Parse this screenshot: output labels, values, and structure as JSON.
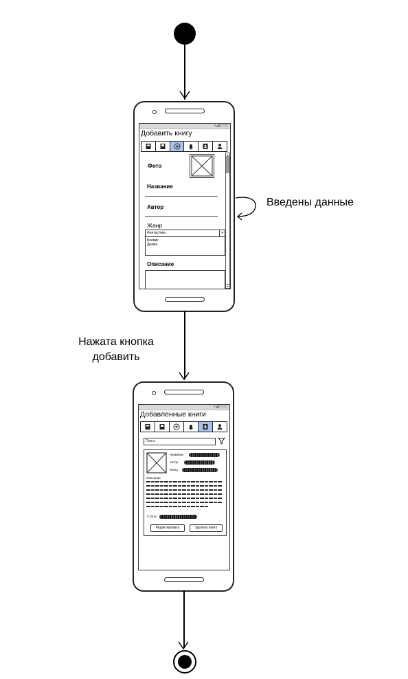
{
  "transitions": {
    "self_loop_label": "Введены данные",
    "add_pressed_label_line1": "Нажата кнопка",
    "add_pressed_label_line2": "добавить"
  },
  "screen1": {
    "title": "Добавить книгу",
    "photo_label": "Фото",
    "name_label": "Название",
    "author_label": "Автор",
    "genre_label": "Жанр",
    "genre_selected": "Фантастика",
    "genre_options": [
      "Боевик",
      "Драма"
    ],
    "description_label": "Описание"
  },
  "screen2": {
    "title": "Добавленные книги",
    "search_placeholder": "Поиск",
    "card": {
      "name_label": "Название",
      "author_label": "Автор",
      "genre_label": "Жанр",
      "description_label": "Описание",
      "status_label": "Статус",
      "edit_button": "Редактировать",
      "delete_button": "Удалить книгу"
    }
  },
  "tab_icons": [
    "book-icon",
    "bookmark-book-icon",
    "add-circle-icon",
    "bell-icon",
    "contact-book-icon",
    "user-icon"
  ],
  "colors": {
    "active_tab": "#a7c4ec"
  }
}
